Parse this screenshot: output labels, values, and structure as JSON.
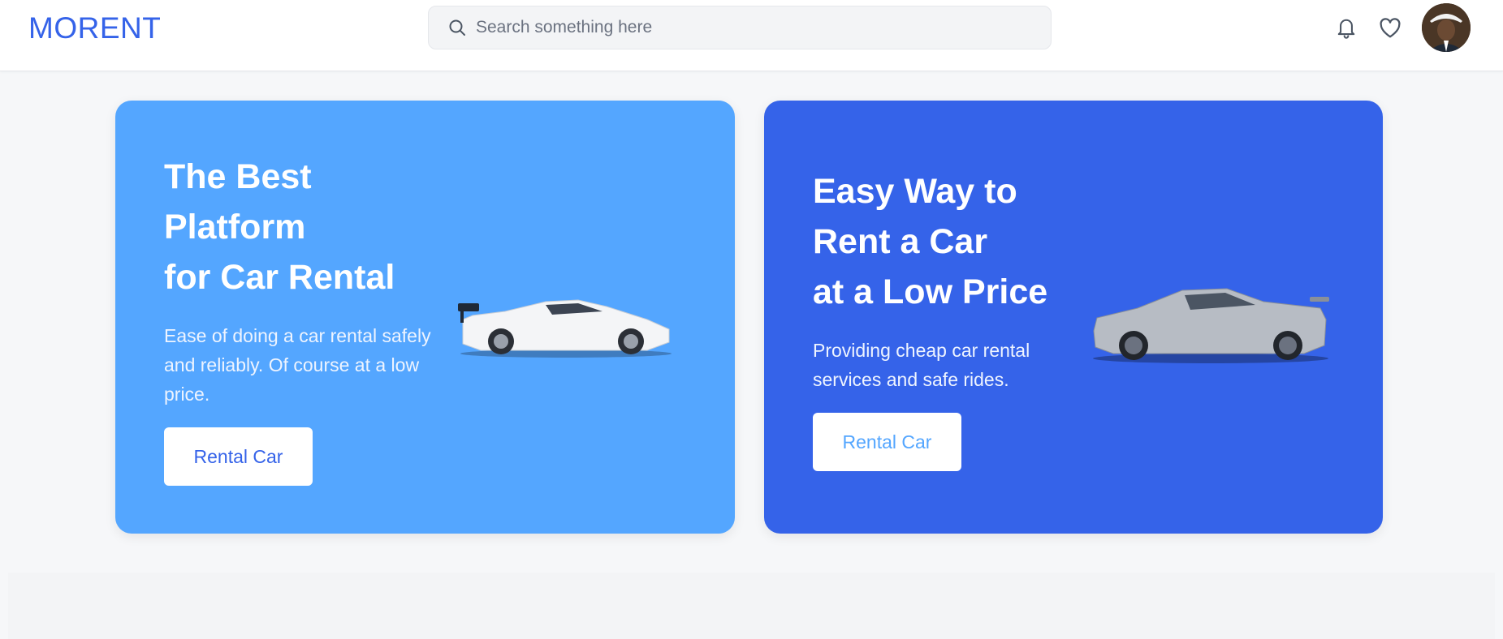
{
  "header": {
    "logo": "MORENT",
    "search_placeholder": "Search something here",
    "icons": [
      "bell-icon",
      "heart-icon"
    ],
    "accent_color": "#3563e9"
  },
  "cards": [
    {
      "title_lines": [
        "The Best",
        "Platform",
        "for Car Rental"
      ],
      "description": "Ease of doing a car rental safely and reliably. Of course at a low price.",
      "button_label": "Rental Car",
      "background": "#54a6ff"
    },
    {
      "title_lines": [
        "Easy Way to",
        "Rent a Car",
        "at a Low Price"
      ],
      "description": "Providing cheap car rental services and safe rides.",
      "button_label": "Rental Car",
      "background": "#3563e9"
    }
  ]
}
